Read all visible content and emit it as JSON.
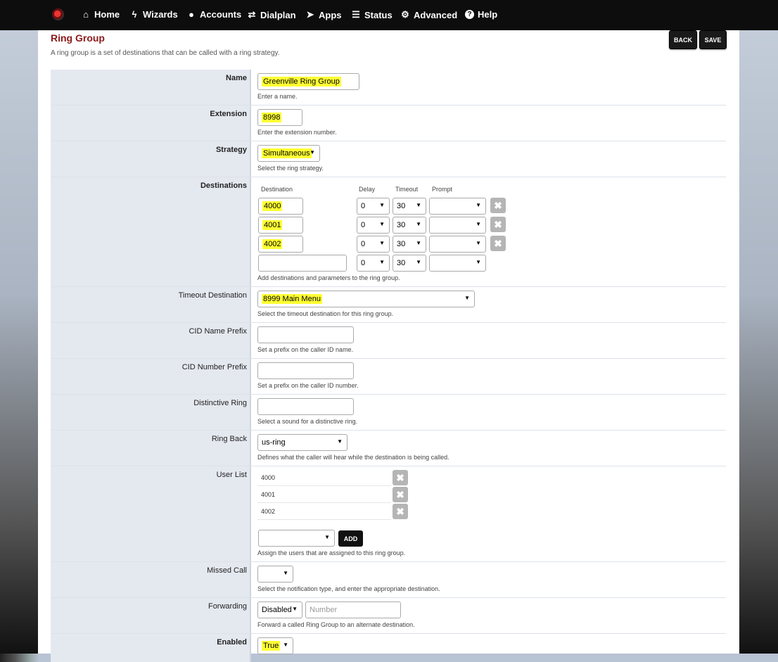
{
  "nav": {
    "items": [
      {
        "label": "Home",
        "icon": "home-icon",
        "glyph": "⌂"
      },
      {
        "label": "Wizards",
        "icon": "bolt-icon",
        "glyph": "ϟ"
      },
      {
        "label": "Accounts",
        "icon": "user-icon",
        "glyph": "●"
      },
      {
        "label": "Dialplan",
        "icon": "exchange-icon",
        "glyph": "⇄"
      },
      {
        "label": "Apps",
        "icon": "send-icon",
        "glyph": "➤"
      },
      {
        "label": "Status",
        "icon": "tasks-icon",
        "glyph": "☰"
      },
      {
        "label": "Advanced",
        "icon": "gear-icon",
        "glyph": "⚙"
      },
      {
        "label": "Help",
        "icon": "question-icon",
        "glyph": "?"
      }
    ]
  },
  "page": {
    "title": "Ring Group",
    "description": "A ring group is a set of destinations that can be called with a ring strategy.",
    "back_label": "BACK",
    "save_label": "SAVE"
  },
  "form": {
    "name": {
      "label": "Name",
      "value": "Greenville Ring Group",
      "help": "Enter a name."
    },
    "extension": {
      "label": "Extension",
      "value": "8998",
      "help": "Enter the extension number."
    },
    "strategy": {
      "label": "Strategy",
      "value": "Simultaneous",
      "help": "Select the ring strategy."
    },
    "destinations": {
      "label": "Destinations",
      "columns": {
        "destination": "Destination",
        "delay": "Delay",
        "timeout": "Timeout",
        "prompt": "Prompt"
      },
      "rows": [
        {
          "destination": "4000",
          "delay": "0",
          "timeout": "30",
          "prompt": ""
        },
        {
          "destination": "4001",
          "delay": "0",
          "timeout": "30",
          "prompt": ""
        },
        {
          "destination": "4002",
          "delay": "0",
          "timeout": "30",
          "prompt": ""
        },
        {
          "destination": "",
          "delay": "0",
          "timeout": "30",
          "prompt": ""
        }
      ],
      "help": "Add destinations and parameters to the ring group."
    },
    "timeout_destination": {
      "label": "Timeout Destination",
      "value": "8999 Main Menu",
      "help": "Select the timeout destination for this ring group."
    },
    "cid_name_prefix": {
      "label": "CID Name Prefix",
      "value": "",
      "help": "Set a prefix on the caller ID name."
    },
    "cid_number_prefix": {
      "label": "CID Number Prefix",
      "value": "",
      "help": "Set a prefix on the caller ID number."
    },
    "distinctive_ring": {
      "label": "Distinctive Ring",
      "value": "",
      "help": "Select a sound for a distinctive ring."
    },
    "ring_back": {
      "label": "Ring Back",
      "value": "us-ring",
      "help": "Defines what the caller will hear while the destination is being called."
    },
    "user_list": {
      "label": "User List",
      "users": [
        "4000",
        "4001",
        "4002"
      ],
      "add_label": "ADD",
      "help": "Assign the users that are assigned to this ring group."
    },
    "missed_call": {
      "label": "Missed Call",
      "value": "",
      "help": "Select the notification type, and enter the appropriate destination."
    },
    "forwarding": {
      "label": "Forwarding",
      "value": "Disabled",
      "placeholder": "Number",
      "help": "Forward a called Ring Group to an alternate destination."
    },
    "enabled": {
      "label": "Enabled",
      "value": "True"
    }
  },
  "colors": {
    "accent": "#8b1a1a",
    "highlight": "#ffff33",
    "nav_bg": "#0d0d0d",
    "label_bg": "#e4e8ef"
  }
}
